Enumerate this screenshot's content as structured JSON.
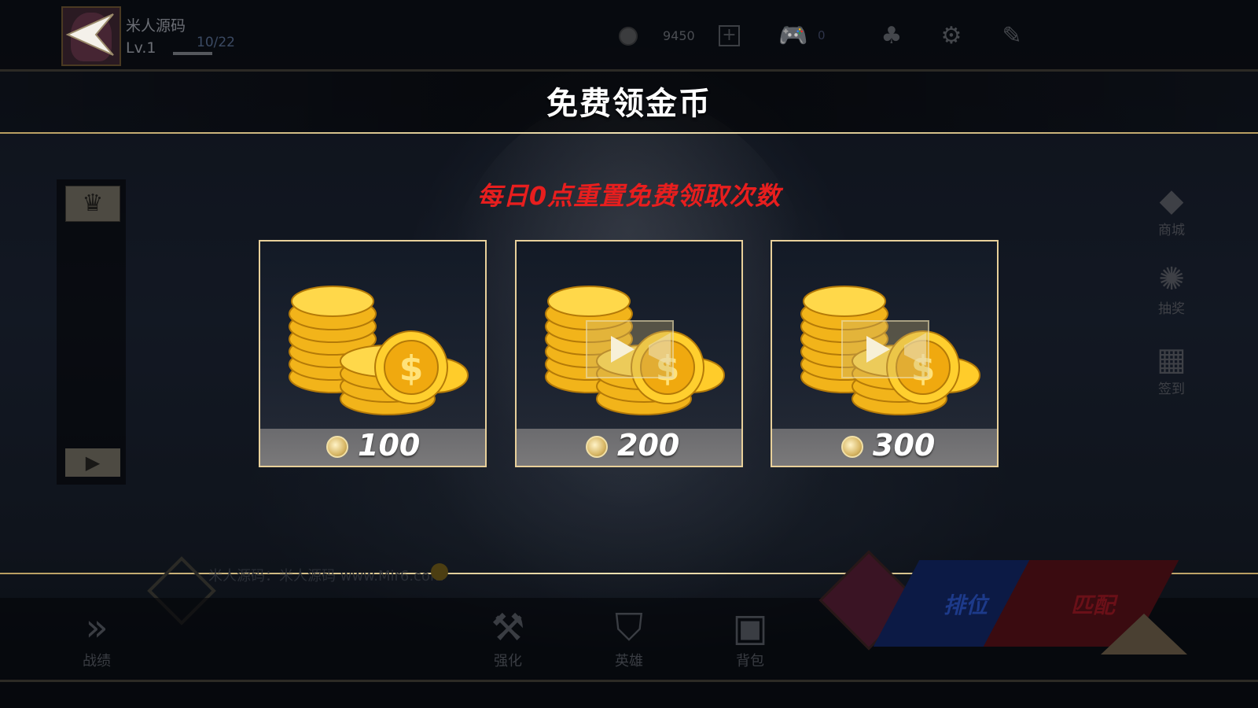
{
  "header": {
    "player_name": "米人源码",
    "level": "Lv.1",
    "exp": "10/22",
    "coins": "9450",
    "gamepad_count": "0",
    "icons": [
      "coin-icon",
      "plus-icon",
      "gamepad-icon",
      "friends-icon",
      "gear-icon",
      "edit-icon"
    ]
  },
  "panel": {
    "title": "免费领金币",
    "subtitle": "每日0点重置免费领取次数",
    "rewards": [
      {
        "amount": "100",
        "video": false
      },
      {
        "amount": "200",
        "video": true
      },
      {
        "amount": "300",
        "video": true
      }
    ]
  },
  "right_menu": [
    {
      "label": "商城",
      "icon": "diamond-icon"
    },
    {
      "label": "抽奖",
      "icon": "wheel-icon"
    },
    {
      "label": "签到",
      "icon": "calendar-icon"
    }
  ],
  "chat": {
    "text": "米人源码：米人源码 www.Mir6.com"
  },
  "bottom_nav": [
    {
      "label": "战绩",
      "icon": "chevrons-icon"
    },
    {
      "label": "强化",
      "icon": "anvil-icon"
    },
    {
      "label": "英雄",
      "icon": "helmet-icon"
    },
    {
      "label": "背包",
      "icon": "backpack-icon"
    }
  ],
  "modes": {
    "ranked": "排位",
    "match": "匹配"
  },
  "colors": {
    "gold": "#e8d09a",
    "subtitle_red": "#e81e1e",
    "ranked_blue": "#0c1a45",
    "match_red": "#3a0b10"
  }
}
